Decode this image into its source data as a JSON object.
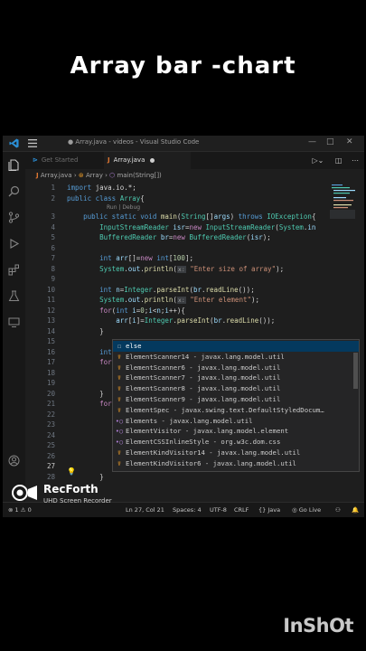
{
  "headline": "Array bar -chart",
  "window": {
    "title": "● Array.java - videos - Visual Studio Code",
    "controls": [
      "—",
      "□",
      "✕"
    ]
  },
  "tabs": [
    {
      "label": "Get Started",
      "icon": "vscode-icon"
    },
    {
      "label": "Array.java",
      "icon": "java-icon",
      "modified": true
    }
  ],
  "breadcrumb": {
    "file": "Array.java",
    "sep": "›",
    "cls": "Array",
    "method": "main(String[])"
  },
  "codelens": "Run | Debug",
  "editor": {
    "current_line": 27,
    "lines": [
      {
        "n": "1",
        "html": "<span class='kw'>import</span> java.io.*;"
      },
      {
        "n": "2",
        "html": "<span class='kw'>public</span> <span class='kw'>class</span> <span class='ty'>Array</span>{"
      },
      {
        "n": "3",
        "html": "    <span class='kw'>public</span> <span class='kw'>static</span> <span class='kw'>void</span> <span class='fn'>main</span>(<span class='ty'>String</span>[]<span class='var'>args</span>) <span class='kw'>throws</span> <span class='ty'>IOException</span>{"
      },
      {
        "n": "4",
        "html": "        <span class='ty'>InputStreamReader</span> <span class='var'>isr</span>=<span class='kw2'>new</span> <span class='ty'>InputStreamReader</span>(<span class='ty'>System</span>.<span class='var'>in</span>"
      },
      {
        "n": "5",
        "html": "        <span class='ty'>BufferedReader</span> <span class='var'>br</span>=<span class='kw2'>new</span> <span class='ty'>BufferedReader</span>(<span class='var'>isr</span>);"
      },
      {
        "n": "6",
        "html": ""
      },
      {
        "n": "7",
        "html": "        <span class='kw'>int</span> <span class='var'>arr</span>[]=<span class='kw2'>new</span> <span class='kw'>int</span>[<span class='num'>100</span>];"
      },
      {
        "n": "8",
        "html": "        <span class='ty'>System</span>.<span class='var'>out</span>.<span class='fn'>println</span>(<span class='hint'>x:</span> <span class='str'>\"Enter size of array\"</span>);"
      },
      {
        "n": "9",
        "html": ""
      },
      {
        "n": "10",
        "html": "        <span class='kw'>int</span> <span class='var'>n</span>=<span class='ty'>Integer</span>.<span class='fn'>parseInt</span>(<span class='var'>br</span>.<span class='fn'>readLine</span>());"
      },
      {
        "n": "11",
        "html": "        <span class='ty'>System</span>.<span class='var'>out</span>.<span class='fn'>println</span>(<span class='hint'>x:</span> <span class='str'>\"Enter element\"</span>);"
      },
      {
        "n": "12",
        "html": "        <span class='kw2'>for</span>(<span class='kw'>int</span> <span class='var'>i</span>=<span class='num'>0</span>;<span class='var'>i</span>&lt;<span class='var'>n</span>;<span class='var'>i</span>++){"
      },
      {
        "n": "13",
        "html": "            <span class='var'>arr</span>[<span class='var'>i</span>]=<span class='ty'>Integer</span>.<span class='fn'>parseInt</span>(<span class='var'>br</span>.<span class='fn'>readLine</span>());"
      },
      {
        "n": "14",
        "html": "        }"
      },
      {
        "n": "15",
        "html": ""
      },
      {
        "n": "16",
        "html": "        <span class='kw'>int</span>"
      },
      {
        "n": "17",
        "html": "        <span class='kw2'>for</span>"
      },
      {
        "n": "18",
        "html": ""
      },
      {
        "n": "19",
        "html": ""
      },
      {
        "n": "20",
        "html": "        }"
      },
      {
        "n": "21",
        "html": "        <span class='kw2'>for</span>"
      },
      {
        "n": "22",
        "html": ""
      },
      {
        "n": "23",
        "html": ""
      },
      {
        "n": "24",
        "html": ""
      },
      {
        "n": "25",
        "html": ""
      },
      {
        "n": "26",
        "html": ""
      },
      {
        "n": "27",
        "html": "                <span class='kw2'>else</span>"
      },
      {
        "n": "28",
        "html": "        }"
      }
    ]
  },
  "autocomplete": {
    "items": [
      {
        "icon": "☐",
        "kind": "keyword",
        "label": "else"
      },
      {
        "icon": "☤",
        "kind": "class",
        "label": "ElementScanner14 - javax.lang.model.util"
      },
      {
        "icon": "☤",
        "kind": "class",
        "label": "ElementScanner6 - javax.lang.model.util"
      },
      {
        "icon": "☤",
        "kind": "class",
        "label": "ElementScanner7 - javax.lang.model.util"
      },
      {
        "icon": "☤",
        "kind": "class",
        "label": "ElementScanner8 - javax.lang.model.util"
      },
      {
        "icon": "☤",
        "kind": "class",
        "label": "ElementScanner9 - javax.lang.model.util"
      },
      {
        "icon": "☤",
        "kind": "class",
        "label": "ElementSpec - javax.swing.text.DefaultStyledDocum…"
      },
      {
        "icon": "•○",
        "kind": "interface",
        "label": "Elements - javax.lang.model.util"
      },
      {
        "icon": "•○",
        "kind": "interface",
        "label": "ElementVisitor - javax.lang.model.element"
      },
      {
        "icon": "•○",
        "kind": "interface",
        "label": "ElementCSSInlineStyle - org.w3c.dom.css"
      },
      {
        "icon": "☤",
        "kind": "class",
        "label": "ElementKindVisitor14 - javax.lang.model.util"
      },
      {
        "icon": "☤",
        "kind": "class",
        "label": "ElementKindVisitor6 - javax.lang.model.util"
      }
    ]
  },
  "statusbar": {
    "errors": "⊗ 1 ⚠ 0",
    "position": "Ln 27, Col 21",
    "spaces": "Spaces: 4",
    "encoding": "UTF-8",
    "eol": "CRLF",
    "language": "{} Java",
    "golive": "◎ Go Live"
  },
  "recorder": {
    "name": "RecForth",
    "subtitle": "UHD Screen Recorder"
  },
  "watermark": "InShOt",
  "colors": {
    "editor_bg": "#1e1e1e",
    "selection": "#04395e",
    "accent": "#007acc"
  }
}
